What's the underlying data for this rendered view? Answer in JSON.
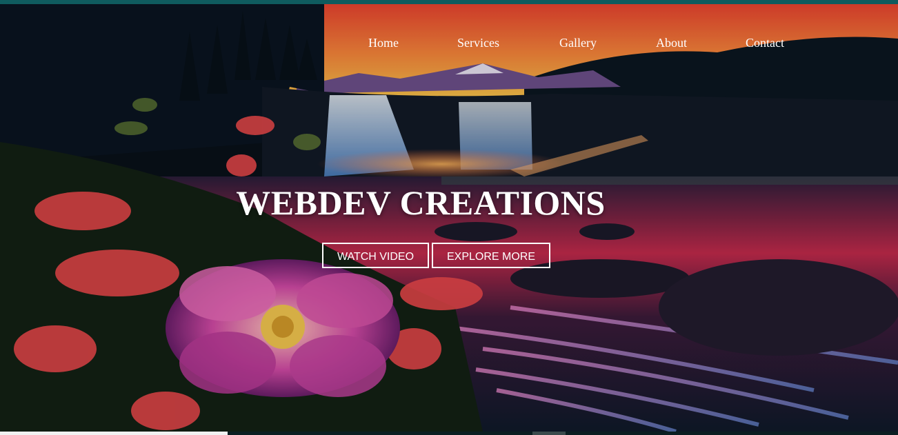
{
  "nav": {
    "items": [
      {
        "label": "Home"
      },
      {
        "label": "Services"
      },
      {
        "label": "Gallery"
      },
      {
        "label": "About"
      },
      {
        "label": "Contact"
      }
    ]
  },
  "hero": {
    "title": "WEBDEV CREATIONS",
    "buttons": {
      "watch_video": "WATCH VIDEO",
      "explore_more": "EXPLORE MORE"
    }
  },
  "colors": {
    "top_bar": "#0f5b5e",
    "text": "#ffffff",
    "button_border": "#ffffff"
  }
}
